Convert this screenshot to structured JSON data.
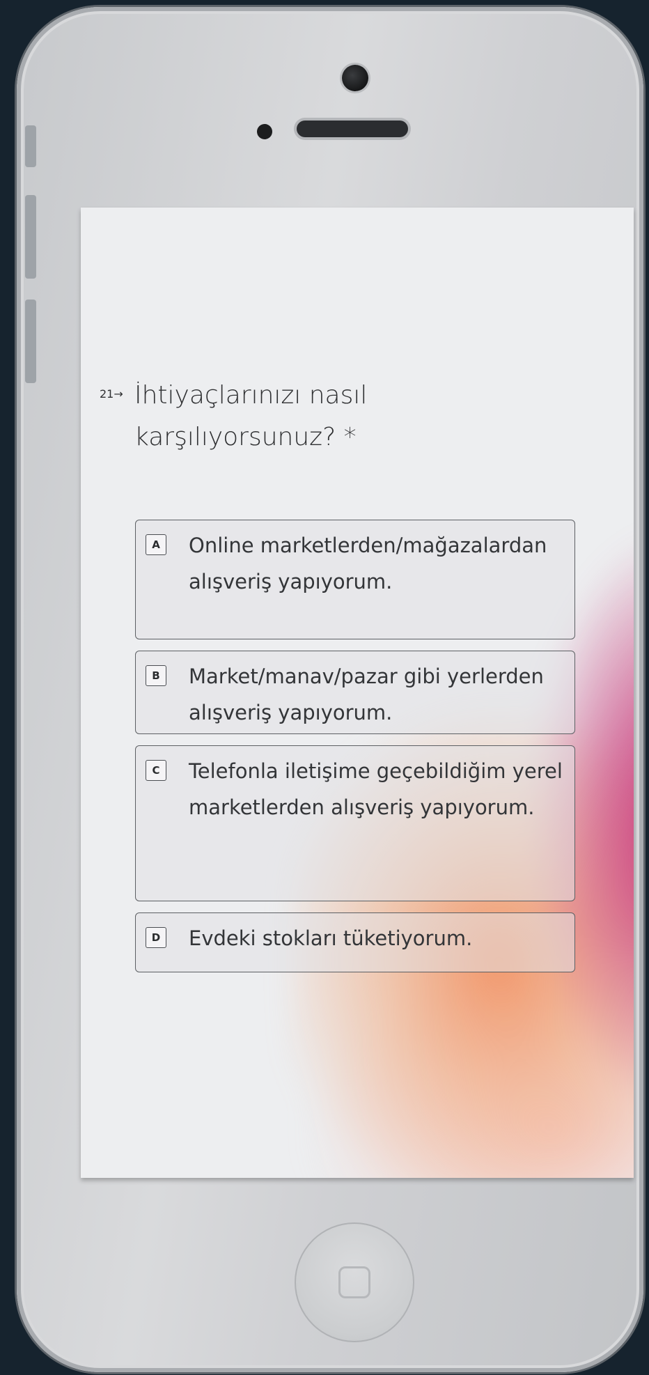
{
  "question": {
    "number": "21→",
    "text": "İhtiyaçlarınızı nasıl karşılıyorsunuz? *"
  },
  "options": [
    {
      "key": "A",
      "label": "Online marketlerden/mağazalardan alışveriş yapıyorum."
    },
    {
      "key": "B",
      "label": "Market/manav/pazar gibi yerlerden alışveriş yapıyorum."
    },
    {
      "key": "C",
      "label": "Telefonla iletişime geçebildiğim yerel marketlerden alışveriş yapıyorum."
    },
    {
      "key": "D",
      "label": "Evdeki stokları tüketiyorum."
    }
  ],
  "icons": {
    "camera": "front-camera-icon",
    "speaker": "earpiece-speaker-icon",
    "home": "home-button-icon"
  }
}
